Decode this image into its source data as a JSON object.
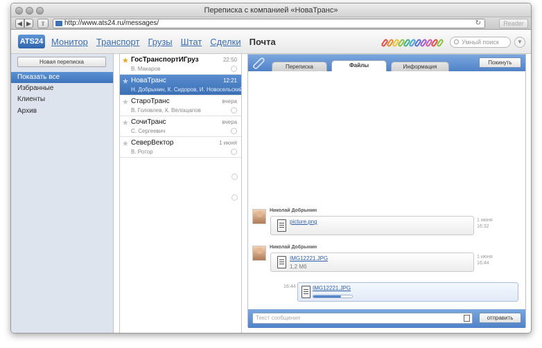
{
  "browser": {
    "window_title": "Переписка с компанией «НоваТранс»",
    "url": "http://www.ats24.ru/messages/",
    "reader_label": "Reader"
  },
  "app": {
    "logo": "ATS24",
    "nav": [
      "Монитор",
      "Транспорт",
      "Грузы",
      "Штат",
      "Сделки",
      "Почта"
    ],
    "active_nav": "Почта",
    "search_placeholder": "Умный поиск",
    "clip_colors": [
      "#e34b4b",
      "#e68a2e",
      "#e8c53a",
      "#8ac43f",
      "#3fb48a",
      "#45a6d6",
      "#5a6fd1",
      "#a45ad1",
      "#d35aa6",
      "#e34b4b",
      "#8ac43f"
    ]
  },
  "sidebar": {
    "new_button": "Новая переписка",
    "items": [
      "Показать все",
      "Избранные",
      "Клиенты",
      "Архив"
    ],
    "active_index": 0
  },
  "conversations": [
    {
      "name": "ГосТранспортИГруз",
      "participants": "В. Макаров",
      "time": "22:50",
      "starred": true,
      "bold": true,
      "selected": false
    },
    {
      "name": "НоваТранс",
      "participants": "Н. Добрынин, К. Сидоров, И. Новосельский",
      "time": "12:21",
      "starred": false,
      "bold": false,
      "selected": true
    },
    {
      "name": "СтароТранс",
      "participants": "В. Головлев, К. Велощапов",
      "time": "вчера",
      "starred": false,
      "bold": false,
      "selected": false
    },
    {
      "name": "СочиТранс",
      "participants": "С. Сергеевич",
      "time": "вчера",
      "starred": false,
      "bold": false,
      "selected": false
    },
    {
      "name": "СеверВектор",
      "participants": "В. Ротор",
      "time": "1 июня",
      "starred": false,
      "bold": false,
      "selected": false
    }
  ],
  "thread": {
    "tabs": [
      "Переписка",
      "Файлы",
      "Информация"
    ],
    "active_tab": "Файлы",
    "leave_button": "Покинуть",
    "messages": [
      {
        "author": "Николай Добрынин",
        "file": "picture.png",
        "size": "",
        "date": "1 июня",
        "time": "16:32"
      },
      {
        "author": "Николай Добрынин",
        "file": "IMG12221.JPG",
        "size": "1,2 Мб",
        "date": "1 июня",
        "time": "16:44"
      }
    ],
    "outgoing": {
      "file": "IMG12221.JPG",
      "time": "16:44",
      "progress": 0.72
    },
    "composer_placeholder": "Текст сообщения",
    "send_button": "отправить"
  }
}
